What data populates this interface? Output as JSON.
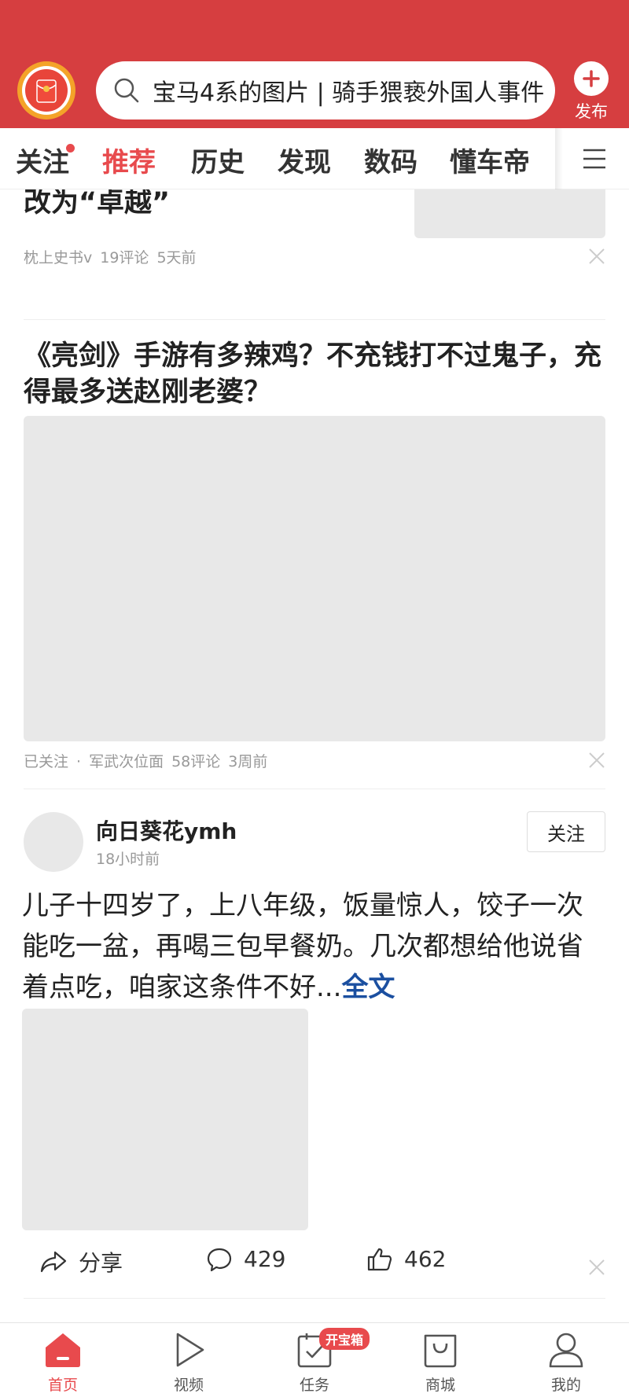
{
  "header": {
    "search_text": "宝马4系的图片 | 骑手猥亵外国人事件",
    "publish_label": "发布"
  },
  "tabs": [
    {
      "label": "关注",
      "has_dot": true
    },
    {
      "label": "推荐",
      "active": true
    },
    {
      "label": "历史"
    },
    {
      "label": "发现"
    },
    {
      "label": "数码"
    },
    {
      "label": "懂车帝"
    }
  ],
  "feed": {
    "item1": {
      "title_partial": "改为“卓越”",
      "source": "枕上史书v",
      "comments": "19评论",
      "time": "5天前"
    },
    "item2": {
      "title": "《亮剑》手游有多辣鸡？不充钱打不过鬼子，充得最多送赵刚老婆？",
      "followed": "已关注",
      "separator": "·",
      "source": "军武次位面",
      "comments": "58评论",
      "time": "3周前"
    },
    "item3": {
      "author": "向日葵花ymh",
      "time": "18小时前",
      "follow_label": "关注",
      "text": "儿子十四岁了，上八年级，饭量惊人，饺子一次能吃一盆，再喝三包早餐奶。几次都想给他说省着点吃，咱家这条件不好...",
      "more_label": "全文",
      "share_label": "分享",
      "comment_count": "429",
      "like_count": "462"
    }
  },
  "bottom_nav": [
    {
      "label": "首页",
      "icon": "home-icon",
      "active": true
    },
    {
      "label": "视频",
      "icon": "play-icon"
    },
    {
      "label": "任务",
      "icon": "task-icon",
      "badge": "开宝箱"
    },
    {
      "label": "商城",
      "icon": "shopping-bag-icon"
    },
    {
      "label": "我的",
      "icon": "person-icon"
    }
  ],
  "colors": {
    "header_red": "#d63e40",
    "accent_red": "#e84a4d",
    "link_blue": "#1b4fa0"
  }
}
